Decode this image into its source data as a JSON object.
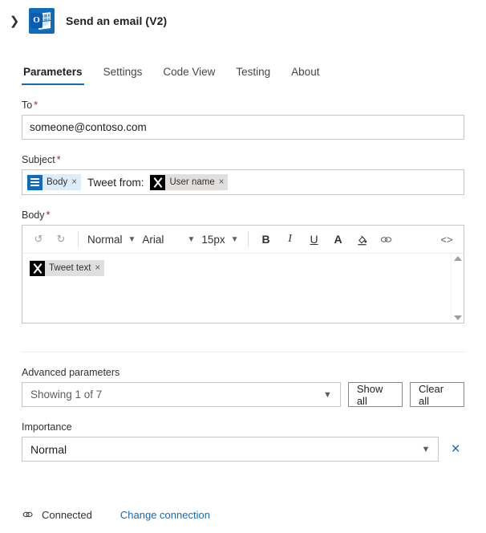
{
  "header": {
    "expand_icon": "chevron-right-icon",
    "app_icon": "outlook-icon",
    "app_icon_letter": "O",
    "title": "Send an email (V2)"
  },
  "tabs": [
    {
      "label": "Parameters",
      "active": true
    },
    {
      "label": "Settings",
      "active": false
    },
    {
      "label": "Code View",
      "active": false
    },
    {
      "label": "Testing",
      "active": false
    },
    {
      "label": "About",
      "active": false
    }
  ],
  "fields": {
    "to": {
      "label": "To",
      "required_marker": "*",
      "value": "someone@contoso.com"
    },
    "subject": {
      "label": "Subject",
      "required_marker": "*",
      "tokens": [
        {
          "icon": "body-lines-icon",
          "label": "Body",
          "remove": "×",
          "style": "blue"
        },
        {
          "icon": "x-logo-icon",
          "label": "User name",
          "remove": "×",
          "style": "grey"
        }
      ],
      "literal_text": "Tweet from:"
    },
    "body": {
      "label": "Body",
      "required_marker": "*",
      "toolbar": {
        "undo": "↺",
        "redo": "↻",
        "style_value": "Normal",
        "font_value": "Arial",
        "size_value": "15px",
        "bold": "B",
        "italic": "I",
        "underline": "U",
        "font_color": "A",
        "highlight": "✐",
        "link": "∞",
        "code_view": "<>"
      },
      "token": {
        "icon": "x-logo-icon",
        "label": "Tweet text",
        "remove": "×",
        "style": "grey"
      },
      "scroll_up": "scroll-up-arrow",
      "scroll_down": "scroll-down-arrow"
    }
  },
  "advanced": {
    "label": "Advanced parameters",
    "select_value": "Showing 1 of 7",
    "show_all_label": "Show all",
    "clear_all_label": "Clear all"
  },
  "importance": {
    "label": "Importance",
    "value": "Normal",
    "clear_icon": "×"
  },
  "footer": {
    "connection_icon": "link-icon",
    "status": "Connected",
    "change_link": "Change connection"
  },
  "colors": {
    "accent": "#0F6CBD",
    "required": "#a4262c",
    "chip_blue": "#deecf9",
    "chip_grey": "#e1dfdd",
    "border": "#c8c6c4"
  }
}
